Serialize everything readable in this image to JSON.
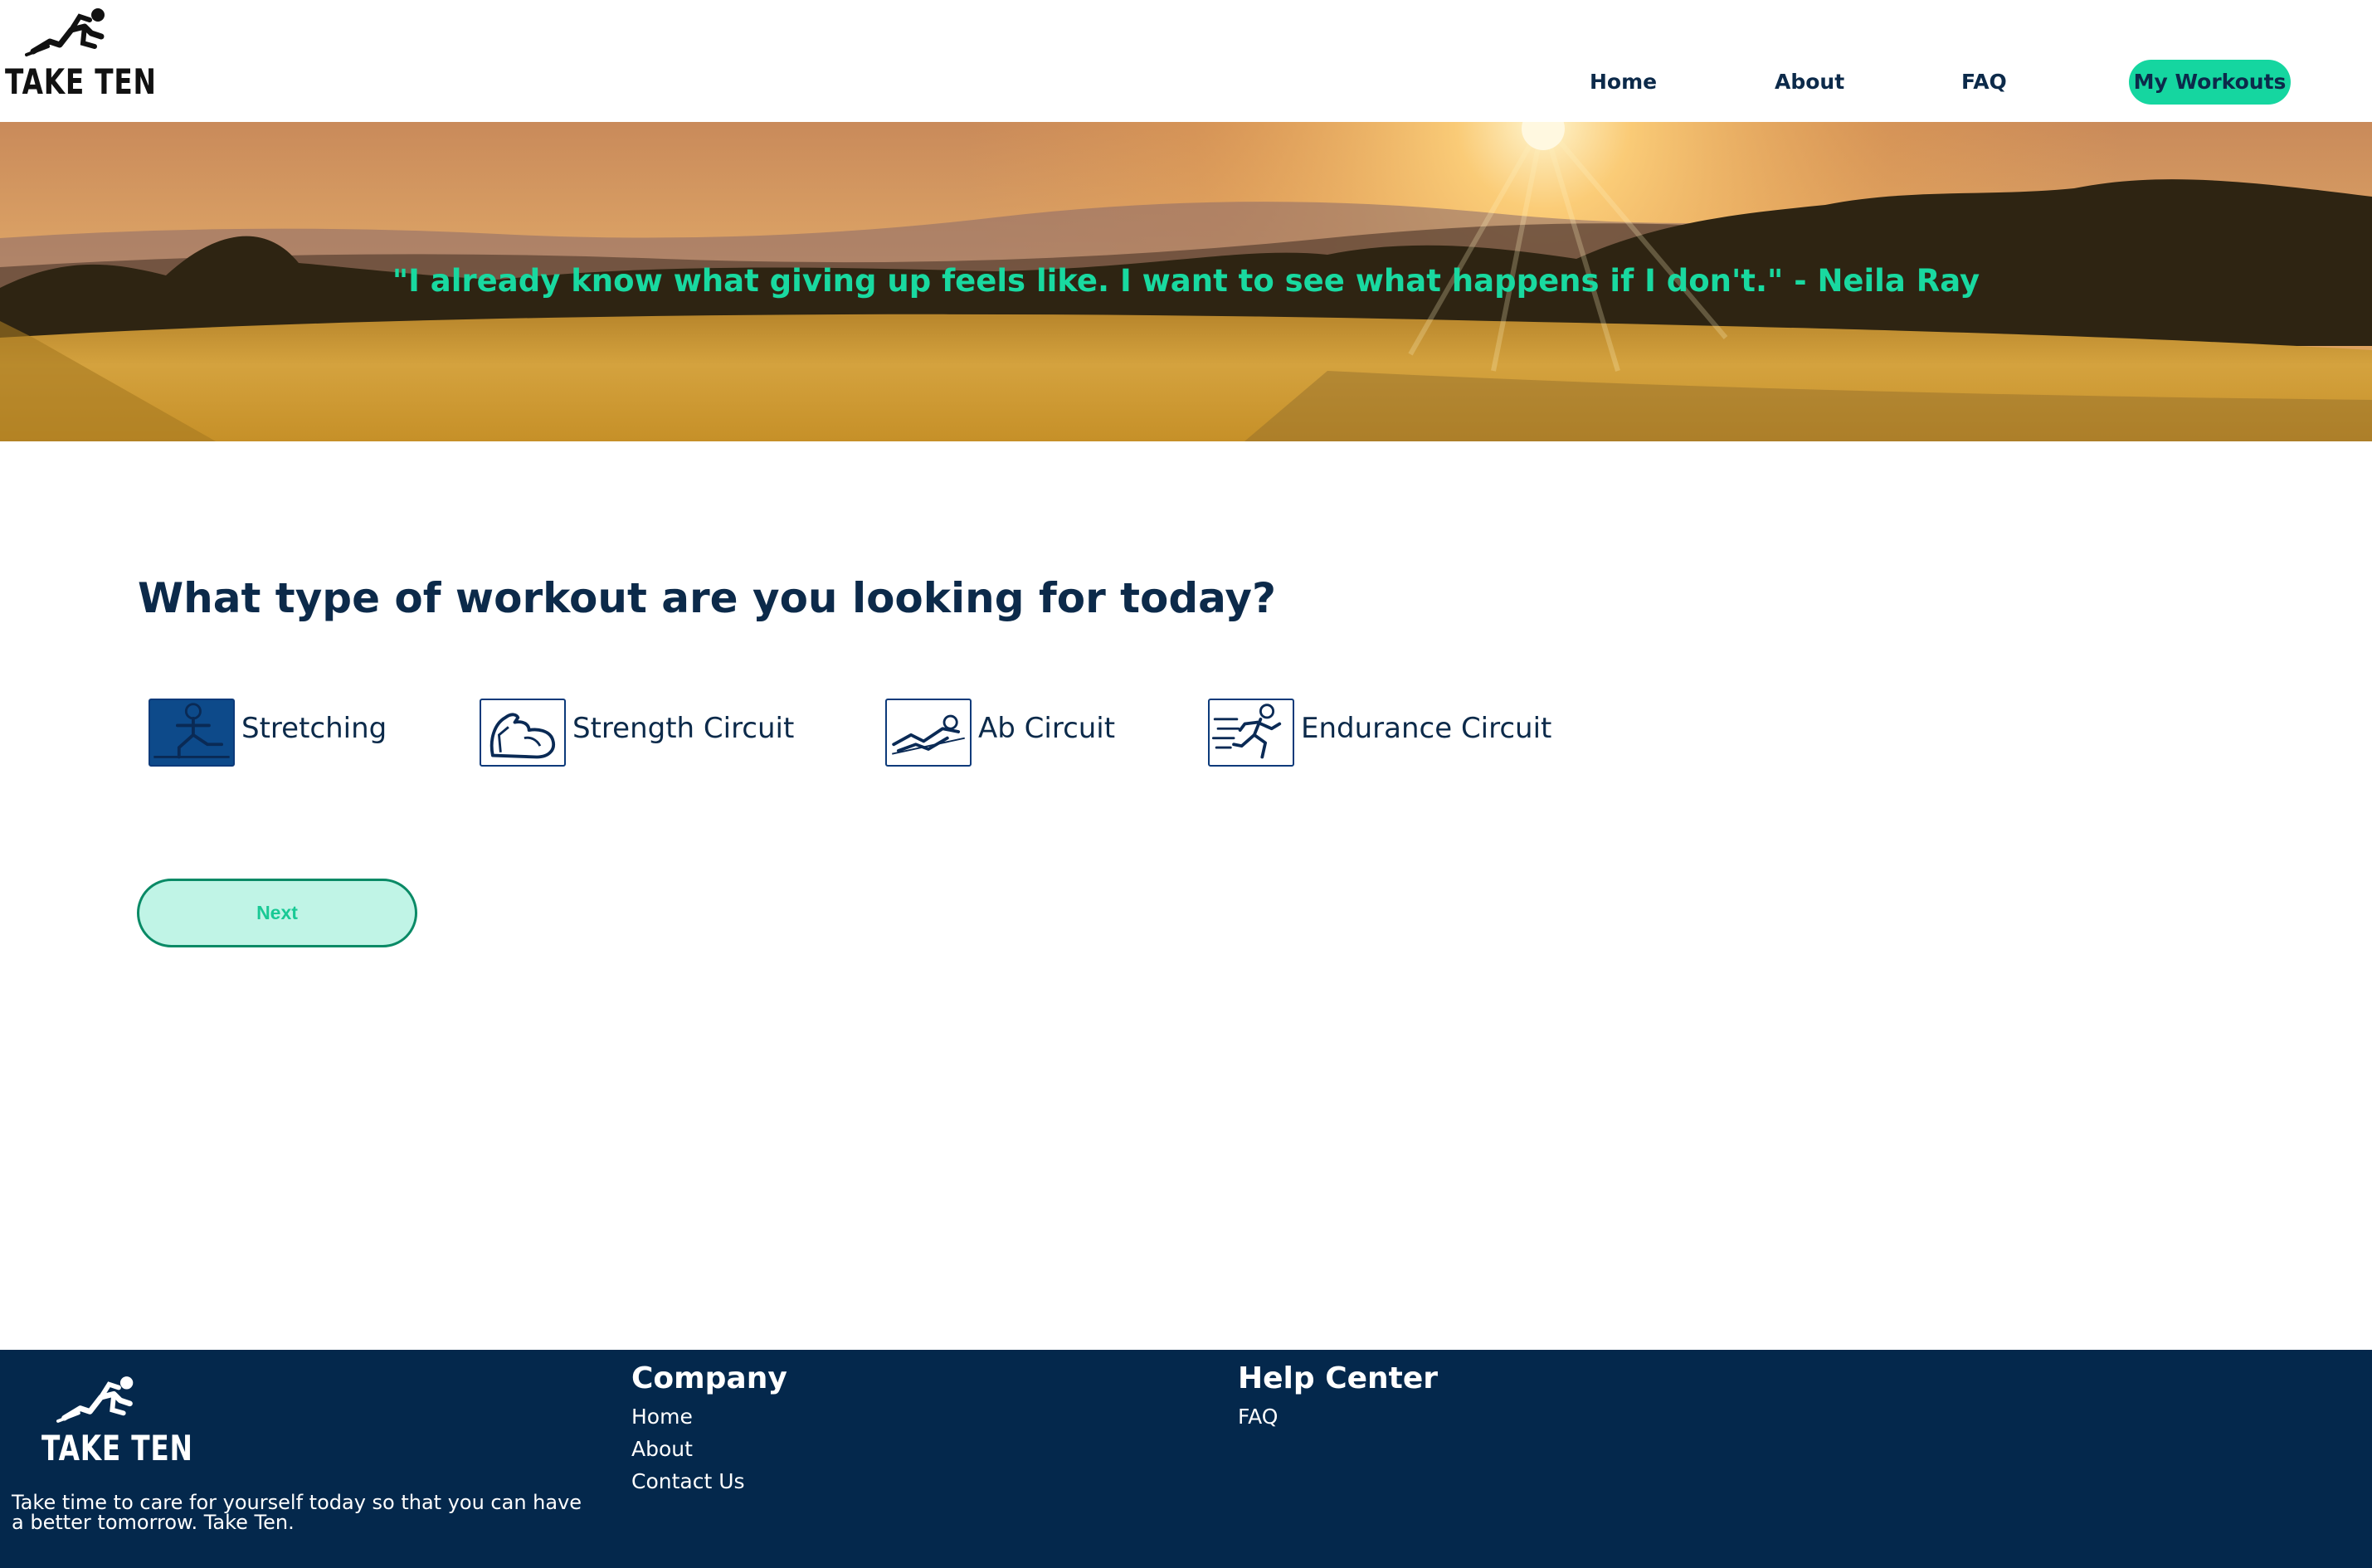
{
  "brand": {
    "name": "TAKE TEN",
    "logo_icon": "runner-icon"
  },
  "nav": {
    "items": [
      {
        "label": "Home"
      },
      {
        "label": "About"
      },
      {
        "label": "FAQ"
      },
      {
        "label": "My Workouts",
        "active": true
      }
    ]
  },
  "hero": {
    "quote": "\"I already know what giving up feels like. I want to see what happens if I don't.\" - Neila Ray",
    "background": "sunset-wheat-field-image"
  },
  "main": {
    "question": "What type of workout are you looking for today?",
    "options": [
      {
        "label": "Stretching",
        "icon": "stretching-icon",
        "selected": true
      },
      {
        "label": "Strength Circuit",
        "icon": "flexed-arm-icon",
        "selected": false
      },
      {
        "label": "Ab Circuit",
        "icon": "situp-icon",
        "selected": false
      },
      {
        "label": "Endurance Circuit",
        "icon": "running-person-icon",
        "selected": false
      }
    ],
    "next_label": "Next"
  },
  "footer": {
    "tagline": "Take time to care for yourself today so that you can have a better tomorrow. Take Ten.",
    "company": {
      "title": "Company",
      "links": [
        "Home",
        "About",
        "Contact Us"
      ]
    },
    "help": {
      "title": "Help Center",
      "links": [
        "FAQ"
      ]
    }
  },
  "colors": {
    "accent": "#15d6a0",
    "navy": "#0c2a4a",
    "footer_bg": "#04284c",
    "quote": "#19d9a0",
    "next_bg": "#c0f4e6"
  }
}
